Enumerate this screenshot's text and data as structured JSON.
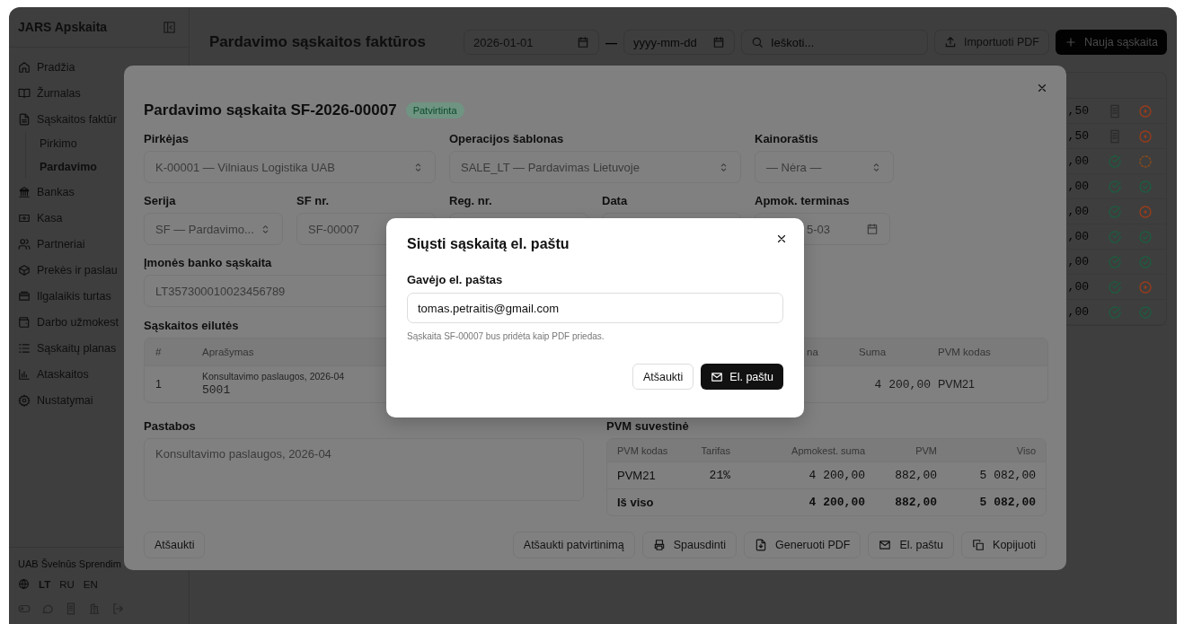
{
  "sidebar": {
    "brand": "JARS Apskaita",
    "items": [
      {
        "label": "Pradžia",
        "selected": false
      },
      {
        "label": "Žurnalas",
        "selected": false
      },
      {
        "label": "Sąskaitos faktūr",
        "selected": false,
        "expanded": true,
        "children": [
          {
            "label": "Pirkimo",
            "selected": false
          },
          {
            "label": "Pardavimo",
            "selected": true
          }
        ]
      },
      {
        "label": "Bankas",
        "selected": false
      },
      {
        "label": "Kasa",
        "selected": false
      },
      {
        "label": "Partneriai",
        "selected": false
      },
      {
        "label": "Prekės ir paslau",
        "selected": false
      },
      {
        "label": "Ilgalaikis turtas",
        "selected": false
      },
      {
        "label": "Darbo užmokest",
        "selected": false
      },
      {
        "label": "Sąskaitų planas",
        "selected": false
      },
      {
        "label": "Ataskaitos",
        "selected": false
      },
      {
        "label": "Nustatymai",
        "selected": false
      }
    ],
    "company": "UAB Švelnūs Sprendim",
    "languages": [
      {
        "label": "LT",
        "selected": true
      },
      {
        "label": "RU",
        "selected": false
      },
      {
        "label": "EN",
        "selected": false
      }
    ]
  },
  "header": {
    "title": "Pardavimo sąskaitos faktūros",
    "date_from": {
      "value": "2026-01-01"
    },
    "separator": "—",
    "date_to": {
      "placeholder": "yyyy-mm-dd"
    },
    "search": {
      "placeholder": "Ieškoti..."
    },
    "import_button": "Importuoti PDF",
    "new_button": "Nauja sąskaita"
  },
  "list_rows": [
    {
      "amount": ",50",
      "document": {
        "kind": "draft"
      },
      "status": {
        "kind": "pending",
        "color": "#9a3c1a"
      }
    },
    {
      "amount": ",50",
      "document": {
        "kind": "draft"
      },
      "status": {
        "kind": "pending",
        "color": "#9a3c1a"
      }
    },
    {
      "amount": ",00",
      "document": {
        "kind": "sent"
      },
      "status": {
        "kind": "partial",
        "color": "#8a4a18"
      }
    },
    {
      "amount": ",00",
      "document": {
        "kind": "sent"
      },
      "status": {
        "kind": "paid",
        "color": "#1d5c40"
      }
    },
    {
      "amount": ",00",
      "document": {
        "kind": "sent"
      },
      "status": {
        "kind": "pending",
        "color": "#9a3c1a"
      }
    },
    {
      "amount": ",00",
      "document": {
        "kind": "sent"
      },
      "status": {
        "kind": "paid",
        "color": "#1d5c40"
      }
    },
    {
      "amount": ",00",
      "document": {
        "kind": "sent"
      },
      "status": {
        "kind": "paid",
        "color": "#1d5c40"
      }
    },
    {
      "amount": ",00",
      "document": {
        "kind": "sent"
      },
      "status": {
        "kind": "pending",
        "color": "#9a3c1a"
      }
    },
    {
      "amount": ",00",
      "document": {
        "kind": "sent"
      },
      "status": {
        "kind": "paid",
        "color": "#1d5c40"
      }
    }
  ],
  "invoice": {
    "title": "Pardavimo sąskaita SF-2026-00007",
    "status": "Patvirtinta",
    "fields": [
      {
        "label": "Pirkėjas",
        "value": "K-00001 — Vilniaus Logistika UAB",
        "kind": "select"
      },
      {
        "label": "Operacijos šablonas",
        "value": "SALE_LT — Pardavimas Lietuvoje",
        "kind": "select"
      },
      {
        "label": "Kainoraštis",
        "value": "— Nėra —",
        "kind": "select"
      },
      {
        "label": "Serija",
        "value": "SF — Pardavimo...",
        "kind": "select"
      },
      {
        "label": "SF nr.",
        "value": "SF-00007",
        "kind": "text"
      },
      {
        "label": "Reg. nr.",
        "kind": "text"
      },
      {
        "label": "Data",
        "kind": "text"
      },
      {
        "label": "Apmok. terminas",
        "value": "5-03",
        "kind": "date"
      },
      {
        "label": "Įmonės banko sąskaita",
        "value": "LT357300010023456789",
        "kind": "text"
      }
    ],
    "lines_title": "Sąskaitos eilutės",
    "lines_columns": [
      "#",
      "Aprašymas",
      "na",
      "Suma",
      "PVM kodas"
    ],
    "lines": [
      {
        "no": "1",
        "description": "Konsultavimo paslaugos, 2026-04",
        "code": "5001",
        "amount": "4 200,00",
        "vat_code": "PVM21"
      }
    ],
    "notes": {
      "label": "Pastabos",
      "value": "Konsultavimo paslaugos, 2026-04"
    },
    "vat_title": "PVM suvestinė",
    "vat_columns": [
      "PVM kodas",
      "Tarifas",
      "Apmokest. suma",
      "PVM",
      "Viso"
    ],
    "vat_rows": [
      {
        "kind": "line",
        "cells": [
          "PVM21",
          "21%",
          "4 200,00",
          "882,00",
          "5 082,00"
        ]
      },
      {
        "kind": "total",
        "cells": [
          "Iš viso",
          "",
          "4 200,00",
          "882,00",
          "5 082,00"
        ]
      }
    ],
    "cancel_button": "Atšaukti",
    "actions": [
      "Atšaukti patvirtinimą",
      "Spausdinti",
      "Generuoti PDF",
      "El. paštu",
      "Kopijuoti"
    ]
  },
  "email_dialog": {
    "title": "Siųsti sąskaitą el. paštu",
    "label": "Gavėjo el. paštas",
    "value": "tomas.petraitis@gmail.com",
    "hint": "Sąskaita SF-00007 bus pridėta kaip PDF priedas.",
    "cancel": "Atšaukti",
    "send": "El. paštu"
  }
}
